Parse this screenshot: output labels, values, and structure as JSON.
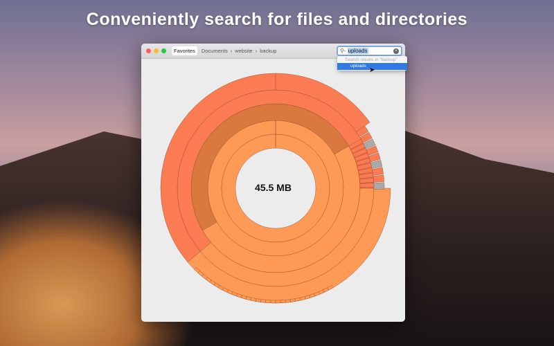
{
  "headline": "Conveniently search for files and directories",
  "toolbar": {
    "favorites": "Favorites",
    "breadcrumb": [
      "Documents",
      "website",
      "backup"
    ],
    "separator": "›"
  },
  "search": {
    "prefix": "-",
    "value": "uploads"
  },
  "dropdown": {
    "header": "Search results in \"backup\"",
    "items": [
      "uploads"
    ]
  },
  "chart": {
    "total": "45.5 MB"
  },
  "colors": {
    "light": "#fe9a55",
    "dark": "#d9793f",
    "red": "#fb7b52",
    "close": "#fc5f57",
    "min": "#fdbc2e",
    "max": "#28c840"
  }
}
